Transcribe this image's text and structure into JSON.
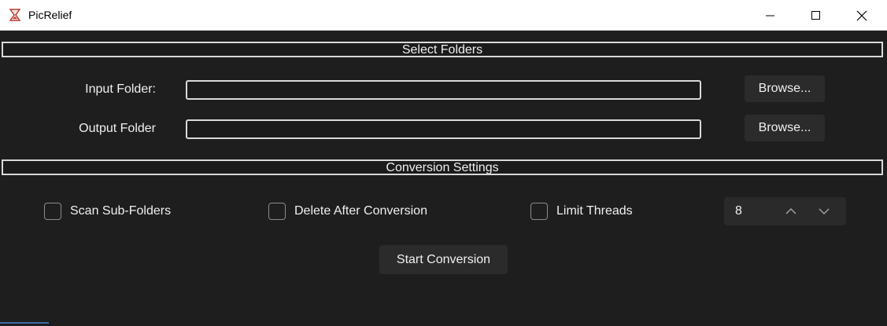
{
  "window": {
    "title": "PicRelief",
    "app_icon": "hourglass-icon",
    "controls": [
      "minimize-icon",
      "maximize-icon",
      "close-icon"
    ]
  },
  "select_folders": {
    "header": "Select Folders",
    "input_label": "Input Folder:",
    "input_value": "",
    "output_label": "Output Folder",
    "output_value": "",
    "browse_label": "Browse..."
  },
  "conversion_settings": {
    "header": "Conversion Settings",
    "scan_subfolders": {
      "label": "Scan Sub-Folders",
      "checked": false
    },
    "delete_after": {
      "label": "Delete After Conversion",
      "checked": false
    },
    "limit_threads": {
      "label": "Limit Threads",
      "checked": false
    },
    "threads_value": "8",
    "start_label": "Start Conversion"
  },
  "colors": {
    "background": "#1e1e1e",
    "button": "#2b2b2b",
    "border": "#d9d9d9",
    "text": "#f0f0f0"
  }
}
